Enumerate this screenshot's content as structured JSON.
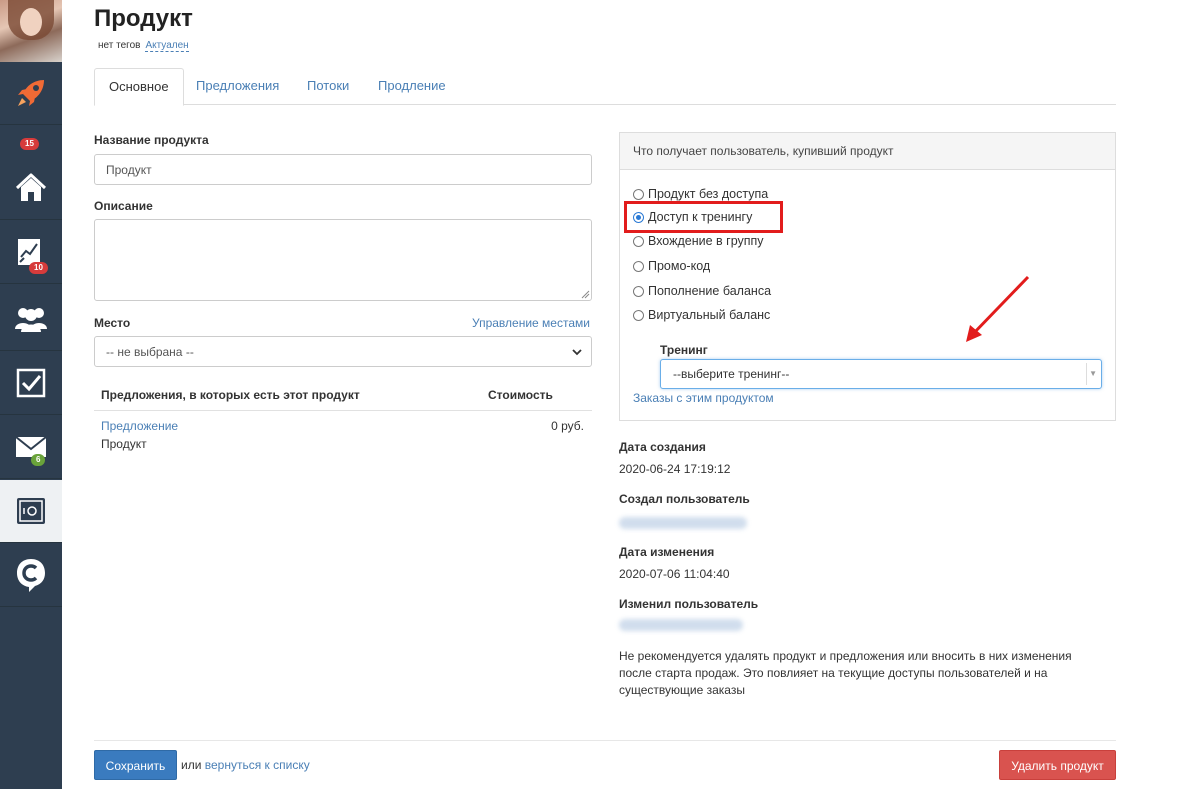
{
  "page": {
    "title": "Продукт",
    "tags": "нет тегов",
    "status": "Актуален"
  },
  "sidebar": {
    "badges": {
      "rocket": "15",
      "chart": "10",
      "mail": "6"
    },
    "icons": [
      "rocket-icon",
      "home-icon",
      "chart-icon",
      "users-icon",
      "checkbox-icon",
      "mail-icon",
      "safe-icon",
      "chat-logo-icon"
    ]
  },
  "tabs": [
    {
      "label": "Основное"
    },
    {
      "label": "Предложения"
    },
    {
      "label": "Потоки"
    },
    {
      "label": "Продление"
    }
  ],
  "form": {
    "name_label": "Название продукта",
    "name_value": "Продукт",
    "description_label": "Описание",
    "description_value": "",
    "place_label": "Место",
    "place_manage_link": "Управление местами",
    "place_value": "-- не выбрана --"
  },
  "offers": {
    "col_offers": "Предложения, в которых есть этот продукт",
    "col_price": "Стоимость",
    "rows": [
      {
        "offer_link": "Предложение",
        "product": "Продукт",
        "price": "0 руб."
      }
    ]
  },
  "access_panel": {
    "heading": "Что получает пользователь, купивший продукт",
    "options": [
      {
        "label": "Продукт без доступа",
        "checked": false
      },
      {
        "label": "Доступ к тренингу",
        "checked": true
      },
      {
        "label": "Вхождение в группу",
        "checked": false
      },
      {
        "label": "Промо-код",
        "checked": false
      },
      {
        "label": "Пополнение баланса",
        "checked": false
      },
      {
        "label": "Виртуальный баланс",
        "checked": false
      }
    ],
    "training_label": "Тренинг",
    "training_placeholder": "--выберите тренинг--",
    "orders_link": "Заказы с этим продуктом"
  },
  "meta": {
    "created_label": "Дата создания",
    "created_value": "2020-06-24 17:19:12",
    "created_by_label": "Создал пользователь",
    "modified_label": "Дата изменения",
    "modified_value": "2020-07-06 11:04:40",
    "modified_by_label": "Изменил пользователь",
    "note": "Не рекомендуется удалять продукт и предложения или вносить в них изменения после старта продаж. Это повлияет на текущие доступы пользователей и на существующие заказы"
  },
  "footer": {
    "save_label": "Сохранить",
    "or_text": "или",
    "back_link": "вернуться к списку",
    "delete_label": "Удалить продукт"
  },
  "colors": {
    "sidebar_bg": "#2e3e50",
    "link": "#4a7fb5",
    "save": "#3a7bbf",
    "delete": "#d9534f",
    "highlight": "#e21c1c"
  }
}
